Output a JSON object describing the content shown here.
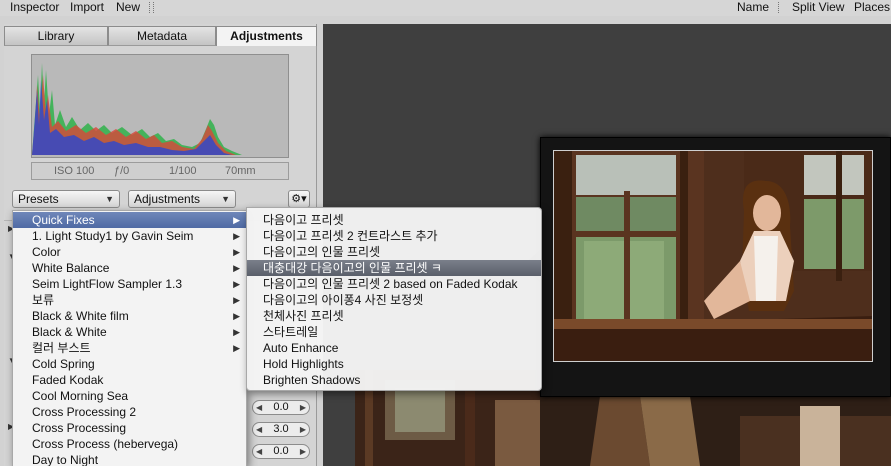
{
  "toolbar": {
    "left": [
      "Inspector",
      "Import",
      "New"
    ],
    "right": [
      "Name",
      "Split View",
      "Places"
    ]
  },
  "tabs": [
    "Library",
    "Metadata",
    "Adjustments"
  ],
  "exif": {
    "iso": "ISO 100",
    "aperture": "ƒ/0",
    "shutter": "1/100",
    "focal": "70mm"
  },
  "presets_button": "Presets",
  "adjustments_button": "Adjustments",
  "gear_icon": "gear-icon",
  "field_values": [
    "0.0",
    "3.0",
    "0.0"
  ],
  "menu1": [
    {
      "label": "Quick Fixes",
      "submenu": true,
      "highlighted": true
    },
    {
      "label": "1. Light Study1 by Gavin Seim",
      "submenu": true
    },
    {
      "label": "Color",
      "submenu": true
    },
    {
      "label": "White Balance",
      "submenu": true
    },
    {
      "label": "Seim LightFlow Sampler 1.3",
      "submenu": true
    },
    {
      "label": "보류",
      "submenu": true
    },
    {
      "label": "Black & White film",
      "submenu": true
    },
    {
      "label": "Black & White",
      "submenu": true
    },
    {
      "label": "컬러 부스트",
      "submenu": true
    },
    {
      "label": "Cold Spring",
      "submenu": false
    },
    {
      "label": "Faded Kodak",
      "submenu": false
    },
    {
      "label": "Cool Morning Sea",
      "submenu": false
    },
    {
      "label": "Cross Processing 2",
      "submenu": false
    },
    {
      "label": "Cross Processing",
      "submenu": false
    },
    {
      "label": "Cross Process (hebervega)",
      "submenu": false
    },
    {
      "label": "Day to Night",
      "submenu": false
    }
  ],
  "menu2": [
    {
      "label": "다음이고 프리셋"
    },
    {
      "label": "다음이고 프리셋 2 컨트라스트 추가"
    },
    {
      "label": "다음이고의 인물 프리셋"
    },
    {
      "label": "대충대강 다음이고의 인물 프리셋 ㅋ",
      "highlighted": true
    },
    {
      "label": "다음이고의 인물 프리셋 2 based on Faded Kodak"
    },
    {
      "label": "다음이고의 아이퐁4 사진 보정셋"
    },
    {
      "label": "천체사진 프리셋"
    },
    {
      "label": "스타트레일"
    },
    {
      "label": "Auto Enhance"
    },
    {
      "label": "Hold Highlights"
    },
    {
      "label": "Brighten Shadows"
    }
  ]
}
